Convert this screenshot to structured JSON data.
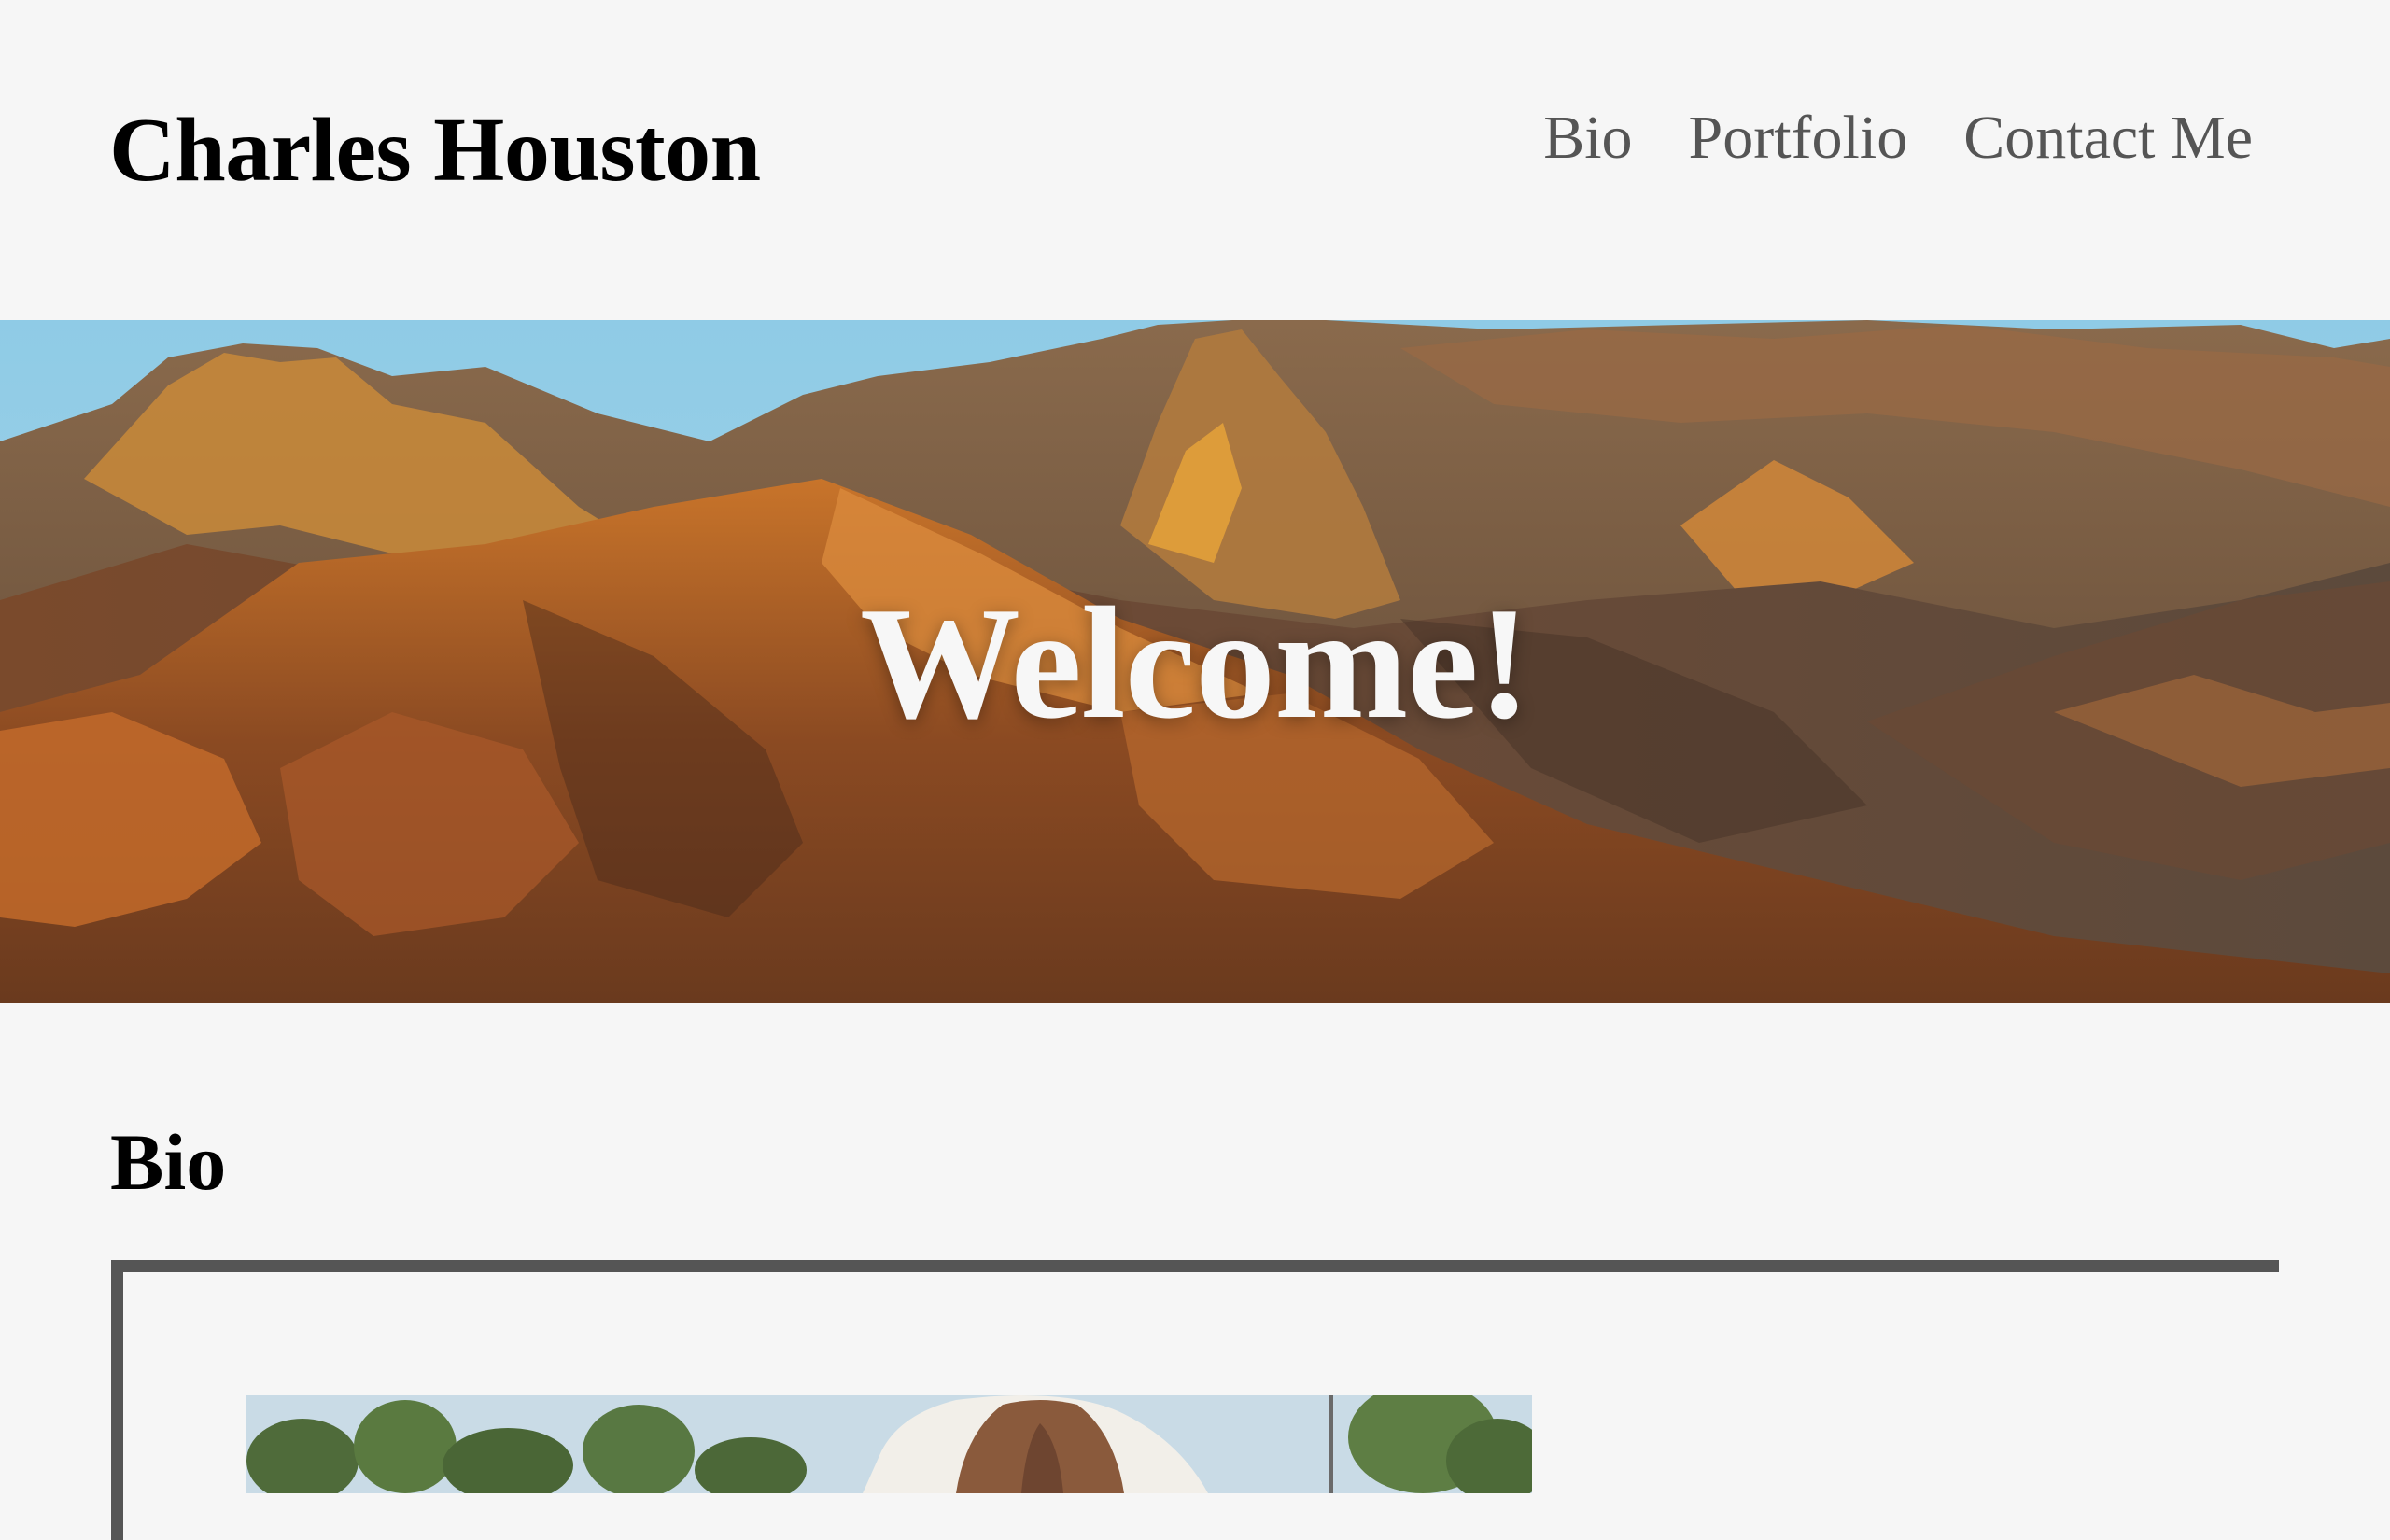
{
  "header": {
    "site_title": "Charles Houston",
    "nav": [
      {
        "label": "Bio"
      },
      {
        "label": "Portfolio"
      },
      {
        "label": "Contact Me"
      }
    ]
  },
  "hero": {
    "title": "Welcome!",
    "image_description": "mountain-landscape-photo"
  },
  "bio": {
    "heading": "Bio",
    "photo_description": "bio-photo"
  },
  "colors": {
    "background": "#f6f6f6",
    "nav_text": "#555555",
    "card_border": "#555555",
    "hero_text": "#f7f7f7"
  }
}
